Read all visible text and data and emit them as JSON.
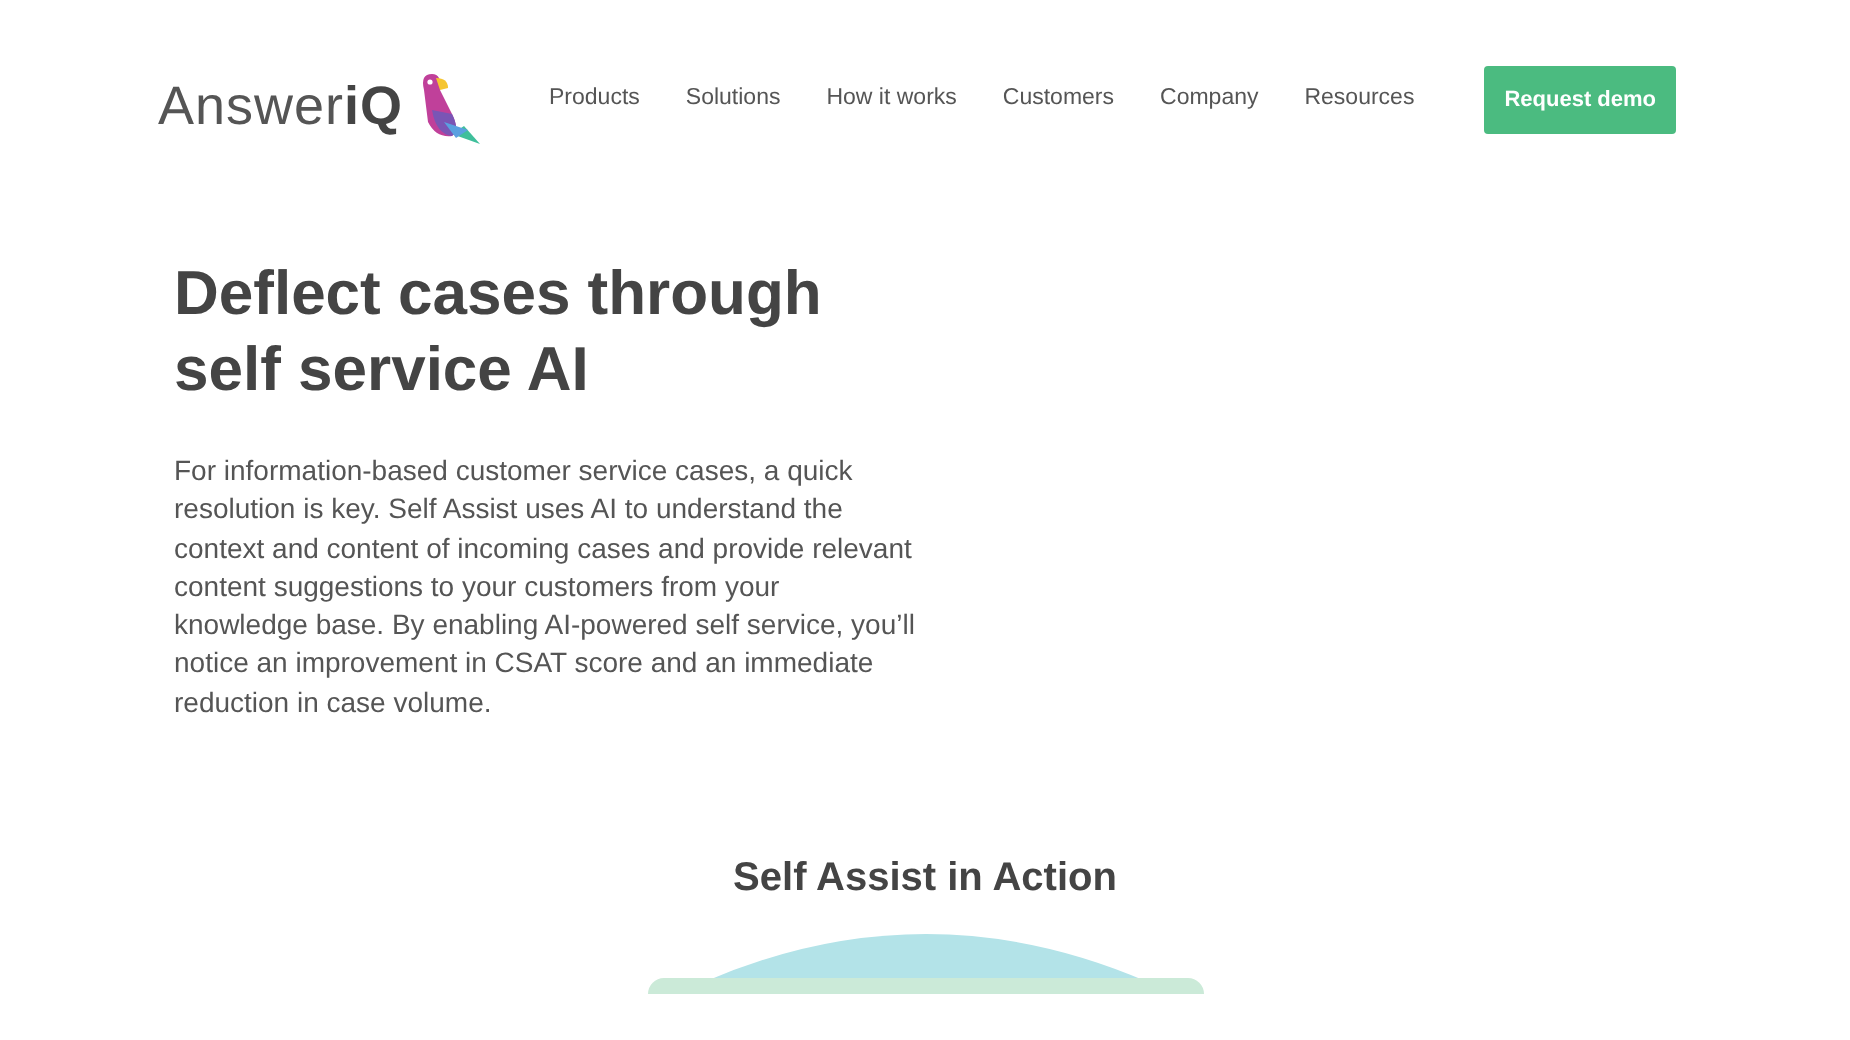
{
  "header": {
    "logo": "Answer**iQ**",
    "nav": [
      {
        "label": "Products"
      },
      {
        "label": "Solutions"
      },
      {
        "label": "How it works"
      },
      {
        "label": "Customers"
      },
      {
        "label": "Company"
      },
      {
        "label": "Resources"
      }
    ],
    "cta": "Request demo"
  },
  "hero": {
    "title": "Deflect cases through self service AI",
    "body": "For information-based customer service cases, a quick resolution is key. Self Assist uses AI to understand the context and content of incoming cases and provide relevant content suggestions to your customers from your knowledge base. By enabling AI-powered self service, you’ll notice an improvement in CSAT score and an immediate reduction in case volume."
  },
  "section": {
    "title": "Self Assist in Action"
  }
}
